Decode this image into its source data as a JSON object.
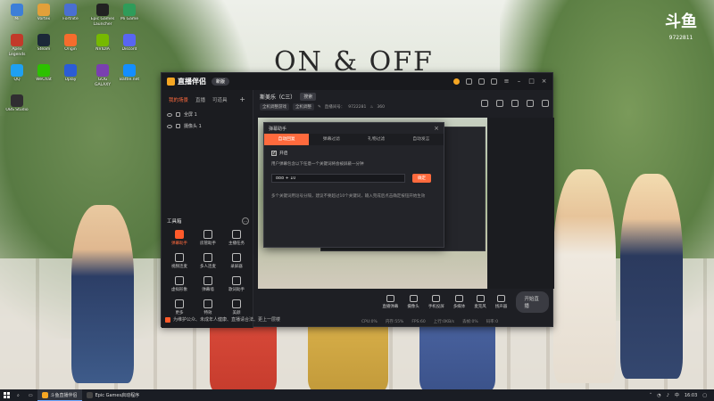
{
  "wallpaper": {
    "title": "ON & OFF",
    "corner_logo": "斗鱼",
    "corner_logo_sub": "9722811"
  },
  "desktop_icons": [
    {
      "label": "Mi",
      "color": "#3d7fd8"
    },
    {
      "label": "Vortex",
      "color": "#e2a03a"
    },
    {
      "label": "Fortnite",
      "color": "#4a6fd1"
    },
    {
      "label": "Epic Games Launcher",
      "color": "#222"
    },
    {
      "label": "Mi Game",
      "color": "#2f9c5a"
    },
    {
      "label": "Apex Legends",
      "color": "#c23a2a"
    },
    {
      "label": "Steam",
      "color": "#1b2838"
    },
    {
      "label": "Origin",
      "color": "#f56c2d"
    },
    {
      "label": "NVIDIA",
      "color": "#76b900"
    },
    {
      "label": "Discord",
      "color": "#5865f2"
    },
    {
      "label": "QQ",
      "color": "#1ea0f2"
    },
    {
      "label": "WeChat",
      "color": "#2dc100"
    },
    {
      "label": "Uplay",
      "color": "#2b5cd6"
    },
    {
      "label": "GOG GALAXY",
      "color": "#7a3fb0"
    },
    {
      "label": "Battle.net",
      "color": "#148eff"
    },
    {
      "label": "OBS Studio",
      "color": "#302e31"
    }
  ],
  "app": {
    "name": "直播伴侣",
    "version_badge": "新版",
    "left_tabs": [
      "我的场景",
      "直播",
      "可道具"
    ],
    "scenes": [
      "全屏 1",
      "摄像头 1"
    ],
    "toolbox_title": "工具箱",
    "tools": [
      {
        "label": "弹幕助手",
        "hot": true
      },
      {
        "label": "房管助手",
        "hot": false
      },
      {
        "label": "主播任务",
        "hot": false
      },
      {
        "label": "视频连麦",
        "hot": false
      },
      {
        "label": "多人连麦",
        "hot": false
      },
      {
        "label": "录屏器",
        "hot": false
      },
      {
        "label": "虚拟形象",
        "hot": false
      },
      {
        "label": "弹幕墙",
        "hot": false
      },
      {
        "label": "歌词助手",
        "hot": false
      },
      {
        "label": "更多",
        "hot": false
      },
      {
        "label": "特效",
        "hot": false
      },
      {
        "label": "美颜",
        "hot": false
      }
    ],
    "notice": "为维护公众、未成年人健康、直播请合法、更上一层楼",
    "room": {
      "title": "斯美乐（C三）",
      "tag": "搜索",
      "sub_chips": [
        "全机调整游戏",
        "全机调整"
      ],
      "room_label": "直播间号：",
      "room_id": "9722281",
      "fans": "360"
    },
    "controls": [
      "直播弹幕",
      "摄像头",
      "手机投屏",
      "多媒体",
      "麦克风",
      "扬声器"
    ],
    "start_button": "开始直播",
    "status": [
      "CPU:0%",
      "内存:55%",
      "FPS:60",
      "上行:0KB/s",
      "丢帧:0%",
      "码率:0"
    ]
  },
  "dialog": {
    "title": "弹幕助手",
    "tabs": [
      "自动回复",
      "弹幕过滤",
      "礼物过滤",
      "自动发言"
    ],
    "active_tab": 0,
    "checkbox_label": "开启",
    "checked": true,
    "description": "用户弹幕包含以下任意一个关键词将会被屏蔽一分钟",
    "input_value": "888 + 10",
    "ok_label": "确定",
    "hint": "多个关键词用逗号分隔，建议不要超过10个关键词，输入完成后点击确定按钮开始生效"
  },
  "taskbar": {
    "items": [
      {
        "label": "斗鱼直播伴侣",
        "color": "#f5a623",
        "active": true
      },
      {
        "label": "Epic Games启动程序",
        "color": "#444",
        "active": false
      }
    ],
    "time": "16:03",
    "lang": "中"
  }
}
